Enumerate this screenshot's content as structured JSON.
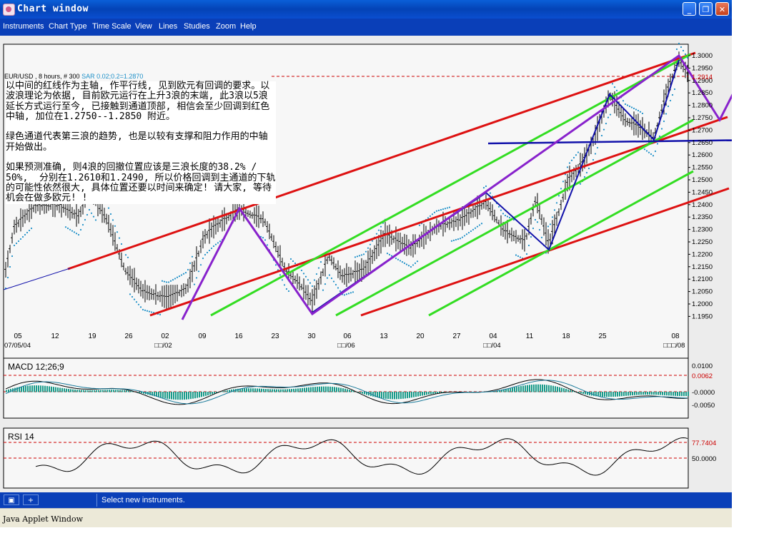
{
  "window": {
    "title": "Chart window",
    "minimize_label": "_",
    "restore_label": "❐",
    "close_label": "✕"
  },
  "menu": {
    "items": [
      "Instruments",
      "Chart Type",
      "Time Scale",
      "View",
      "Lines",
      "Studies",
      "Zoom",
      "Help"
    ]
  },
  "chart_info": {
    "instrument": "EUR/USD , 8 hours, # 300",
    "sar_label": "SAR 0.02;0.2=1.2870"
  },
  "annotation": {
    "paragraph1": "以中间的红线作为主轴, 作平行线, 见到欧元有回调的要求。以波浪理论为依据, 目前欧元运行在上升3浪的末端, 此3浪以5浪延长方式运行至今, 已接触到通道顶部, 相信会至少回调到红色中轴, 加位在1.2750--1.2850 附近。",
    "paragraph2": "绿色通道代表第三浪的趋势, 也是以较有支撑和阻力作用的中轴开始做出。",
    "paragraph3": "如果预测准确, 则4浪的回撤位置应该是三浪长度的38.2% / 50%,  分别在1.2610和1.2490, 所以价格回调到主通道的下轨的可能性依然很大, 具体位置还要以时间来确定! 请大家, 等待机会在做多欧元! !"
  },
  "price_axis": {
    "ticks": [
      "1.3000",
      "1.2950",
      "1.2900",
      "1.2850",
      "1.2800",
      "1.2750",
      "1.2700",
      "1.2650",
      "1.2600",
      "1.2550",
      "1.2500",
      "1.2450",
      "1.2400",
      "1.2350",
      "1.2300",
      "1.2250",
      "1.2200",
      "1.2150",
      "1.2100",
      "1.2050",
      "1.2000",
      "1.1950"
    ],
    "current_price": "1.2914",
    "color_current": "#cc0000"
  },
  "time_axis": {
    "days": [
      "05",
      "12",
      "19",
      "26",
      "02",
      "09",
      "16",
      "23",
      "30",
      "06",
      "13",
      "20",
      "27",
      "04",
      "11",
      "18",
      "25",
      "08"
    ],
    "months": [
      "07/05/04",
      "□□/02",
      "□□/06",
      "□□/04",
      "□□□/08"
    ]
  },
  "macd": {
    "label": "MACD 12;26;9",
    "ticks": [
      "0.0100",
      "0.0062",
      "-0.0000",
      "-0.0050"
    ]
  },
  "rsi": {
    "label": "RSI 14",
    "ticks": [
      "77.7404",
      "50.0000"
    ]
  },
  "status": {
    "text": "Select new instruments.",
    "button1": "▣",
    "button2": "+"
  },
  "applet": {
    "text": "Java Applet Window"
  },
  "colors": {
    "title_bar": "#0443b6",
    "menu_bar": "#0a3fb8",
    "red_channel": "#dd1111",
    "green_channel": "#33dd22",
    "purple_wave": "#8822cc",
    "blue_wave": "#1111aa",
    "sar_dots": "#1e90c8",
    "macd_histogram": "#1a9b8a"
  }
}
